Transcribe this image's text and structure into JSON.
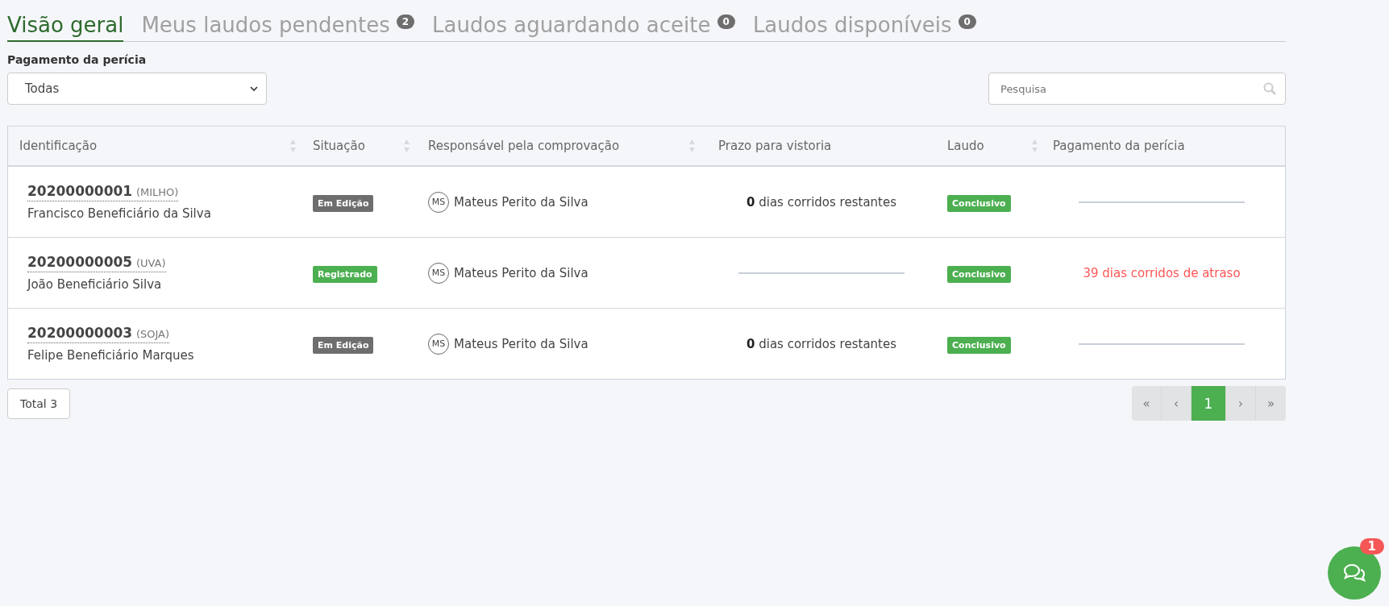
{
  "tabs": [
    {
      "label": "Visão geral",
      "selected": true
    },
    {
      "label": "Meus laudos pendentes",
      "selected": false,
      "count": "2"
    },
    {
      "label": "Laudos aguardando aceite",
      "selected": false,
      "count": "0"
    },
    {
      "label": "Laudos disponíveis",
      "selected": false,
      "count": "0"
    }
  ],
  "filter": {
    "label": "Pagamento da perícia",
    "value": "Todas"
  },
  "search": {
    "placeholder": "Pesquisa"
  },
  "table": {
    "columns": [
      {
        "label": "Identificação",
        "sortable": true
      },
      {
        "label": "Situação",
        "sortable": true
      },
      {
        "label": "Responsável pela comprovação",
        "sortable": true
      },
      {
        "label": "Prazo para vistoria",
        "sortable": false
      },
      {
        "label": "Laudo",
        "sortable": true
      },
      {
        "label": "Pagamento da perícia",
        "sortable": false
      }
    ],
    "rows": [
      {
        "id": "20200000001",
        "crop": "(MILHO)",
        "beneficiary": "Francisco Beneficiário da Silva",
        "status": {
          "label": "Em Edição",
          "color": "#6e6e6e"
        },
        "initials": "MS",
        "responsible": "Mateus Perito da Silva",
        "deadline": {
          "kind": "remaining",
          "text": "**0** dias corridos restantes"
        },
        "report": {
          "label": "Conclusivo",
          "color": "#4caf50"
        },
        "payment": {
          "kind": "none"
        }
      },
      {
        "id": "20200000005",
        "crop": "(UVA)",
        "beneficiary": "João Beneficiário Silva",
        "status": {
          "label": "Registrado",
          "color": "#4caf50"
        },
        "initials": "MS",
        "responsible": "Mateus Perito da Silva",
        "deadline": {
          "kind": "none"
        },
        "report": {
          "label": "Conclusivo",
          "color": "#4caf50"
        },
        "payment": {
          "kind": "overdue",
          "text": "39 dias corridos de atraso"
        }
      },
      {
        "id": "20200000003",
        "crop": "(SOJA)",
        "beneficiary": "Felipe Beneficiário Marques",
        "status": {
          "label": "Em Edição",
          "color": "#6e6e6e"
        },
        "initials": "MS",
        "responsible": "Mateus Perito da Silva",
        "deadline": {
          "kind": "remaining",
          "text": "**0** dias corridos restantes"
        },
        "report": {
          "label": "Conclusivo",
          "color": "#4caf50"
        },
        "payment": {
          "kind": "none"
        }
      }
    ]
  },
  "total": "Total 3",
  "pagination": [
    {
      "label": "«",
      "selected": false
    },
    {
      "label": "‹",
      "selected": false
    },
    {
      "label": "1",
      "selected": true
    },
    {
      "label": "›",
      "selected": false
    },
    {
      "label": "»",
      "selected": false
    }
  ],
  "chat": {
    "badge": "1"
  }
}
